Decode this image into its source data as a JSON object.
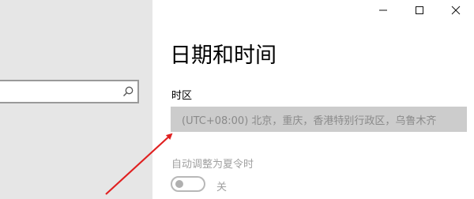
{
  "search": {
    "value": "",
    "icon": "search-icon"
  },
  "window": {
    "controls": [
      "minimize-icon",
      "maximize-icon",
      "close-icon"
    ]
  },
  "page": {
    "title": "日期和时间"
  },
  "timezone": {
    "label": "时区",
    "value": "(UTC+08:00) 北京，重庆，香港特别行政区，乌鲁木齐"
  },
  "dst": {
    "label": "自动调整为夏令时",
    "toggle_state": "关",
    "enabled": false
  },
  "annotation": {
    "color": "#e02020",
    "icon": "red-arrow"
  }
}
